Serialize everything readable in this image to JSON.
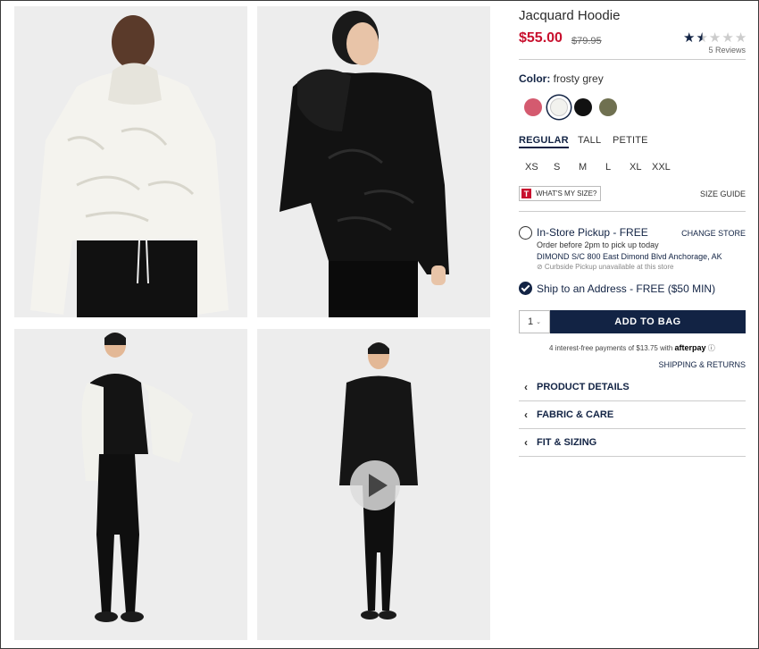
{
  "product": {
    "title": "Jacquard Hoodie",
    "price": "$55.00",
    "original_price": "$79.95",
    "rating": 2.5,
    "reviews": "5 Reviews"
  },
  "color": {
    "label": "Color:",
    "selected": "frosty grey",
    "swatches": [
      {
        "name": "pink",
        "hex": "#d45a6f"
      },
      {
        "name": "frosty grey",
        "hex": "#f2f2ee"
      },
      {
        "name": "black",
        "hex": "#111111"
      },
      {
        "name": "olive",
        "hex": "#6f7050"
      }
    ]
  },
  "fits": [
    "REGULAR",
    "TALL",
    "PETITE"
  ],
  "sizes": [
    "XS",
    "S",
    "M",
    "L",
    "XL",
    "XXL"
  ],
  "size_help": {
    "badge": "T",
    "whats_my_size": "WHAT'S MY SIZE?",
    "size_guide": "SIZE GUIDE"
  },
  "pickup": {
    "title": "In-Store Pickup - FREE",
    "change": "CHANGE STORE",
    "line1": "Order before 2pm to pick up today",
    "store": "DIMOND S/C 800 East Dimond Blvd  Anchorage, AK",
    "curbside": "⊘ Curbside Pickup unavailable at this store"
  },
  "ship": {
    "title": "Ship to an Address - FREE ($50 MIN)"
  },
  "cart": {
    "quantity": "1",
    "add_to_bag": "ADD TO BAG"
  },
  "afterpay": {
    "text": "4 interest-free payments of $13.75 with",
    "brand": "afterpay",
    "info": "ⓘ"
  },
  "shipping_returns": "SHIPPING & RETURNS",
  "accordion": [
    "PRODUCT DETAILS",
    "FABRIC & CARE",
    "FIT & SIZING"
  ],
  "colors": {
    "navy": "#122344",
    "sale_red": "#c8102e",
    "photo_bg": "#ededed"
  }
}
